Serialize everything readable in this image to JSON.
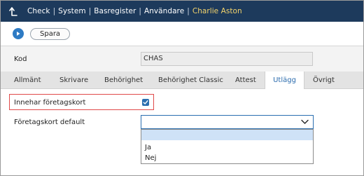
{
  "header": {
    "breadcrumb": [
      "Check",
      "System",
      "Basregister",
      "Användare"
    ],
    "separator": "|",
    "current_user": "Charlie Aston",
    "back_icon": "back-arrow-icon",
    "colors": {
      "background": "#1d3a5c",
      "user_name": "#f3d36b"
    }
  },
  "toolbar": {
    "run_icon": "play-icon",
    "save_label": "Spara"
  },
  "form": {
    "kod_label": "Kod",
    "kod_value": "CHAS"
  },
  "tabs": [
    {
      "label": "Allmänt",
      "active": false
    },
    {
      "label": "Skrivare",
      "active": false
    },
    {
      "label": "Behörighet",
      "active": false
    },
    {
      "label": "Behörighet Classic",
      "active": false
    },
    {
      "label": "Attest",
      "active": false
    },
    {
      "label": "Utlägg",
      "active": true
    },
    {
      "label": "Övrigt",
      "active": false
    }
  ],
  "utlagg": {
    "foretagskort_label": "Innehar företagskort",
    "foretagskort_checked": true,
    "default_label": "Företagskort default",
    "default_value": "",
    "options": [
      "",
      "Ja",
      "Nej"
    ]
  },
  "colors": {
    "accent": "#2b6fb0",
    "highlight": "#e04a4a",
    "option_hover": "#cfe2f7"
  }
}
